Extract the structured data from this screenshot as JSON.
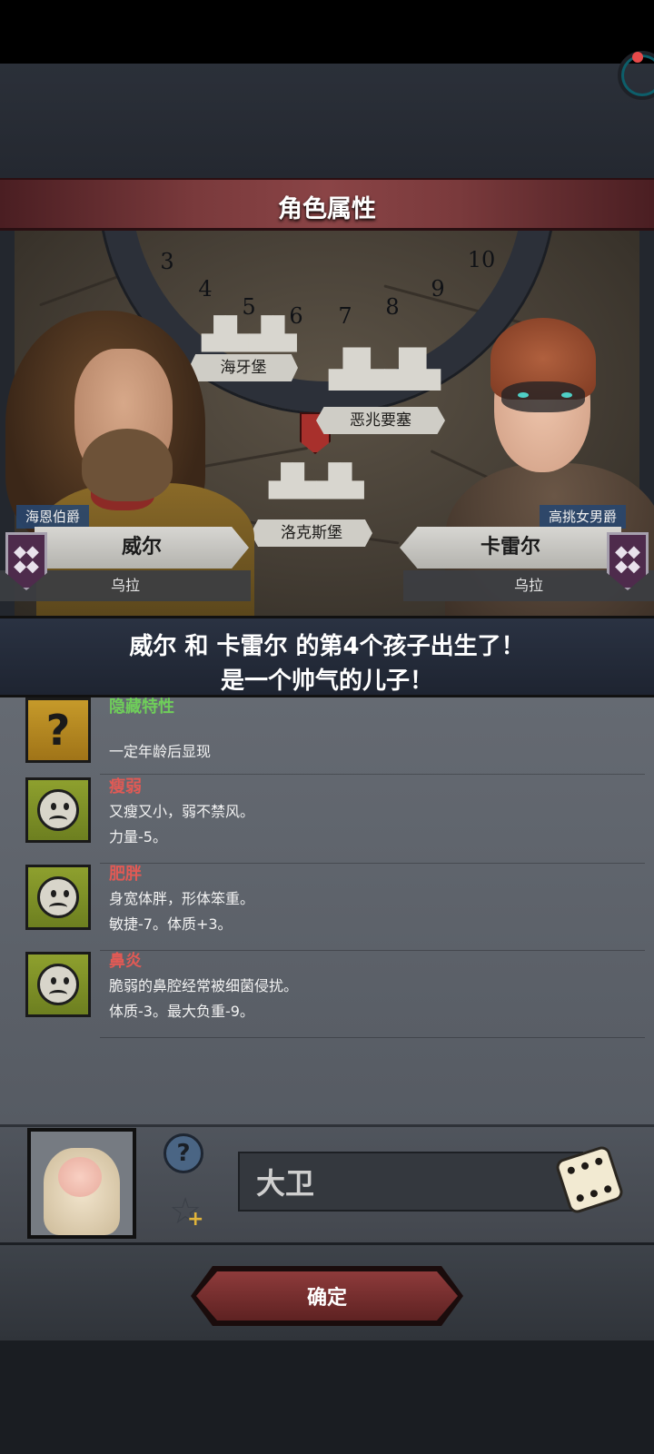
{
  "dialog": {
    "title": "角色属性",
    "confirm_label": "确定"
  },
  "calendar": {
    "numbers": [
      "3",
      "4",
      "5",
      "6",
      "7",
      "8",
      "9",
      "10"
    ]
  },
  "map": {
    "locations": [
      "海牙堡",
      "恶兆要塞",
      "洛克斯堡"
    ]
  },
  "father": {
    "title": "海恩伯爵",
    "name": "威尔",
    "realm": "乌拉"
  },
  "mother": {
    "title": "高挑女男爵",
    "name": "卡雷尔",
    "realm": "乌拉"
  },
  "announcement": {
    "line1": "威尔 和 卡雷尔 的第4个孩子出生了！",
    "line2": "是一个帅气的儿子！"
  },
  "traits": [
    {
      "name": "隐藏特性",
      "desc1": "",
      "desc2": "一定年龄后显现",
      "icon": "question-mark-icon",
      "color": "#6fce5a"
    },
    {
      "name": "瘦弱",
      "desc1": "又瘦又小，弱不禁风。",
      "desc2": "力量-5。",
      "icon": "sad-face-icon",
      "color": "#e05a55"
    },
    {
      "name": "肥胖",
      "desc1": "身宽体胖，形体笨重。",
      "desc2": "敏捷-7。体质+3。",
      "icon": "sad-face-icon",
      "color": "#e05a55"
    },
    {
      "name": "鼻炎",
      "desc1": "脆弱的鼻腔经常被细菌侵扰。",
      "desc2": "体质-3。最大负重-9。",
      "icon": "sad-face-icon",
      "color": "#e05a55"
    }
  ],
  "child": {
    "name_value": "大卫"
  }
}
